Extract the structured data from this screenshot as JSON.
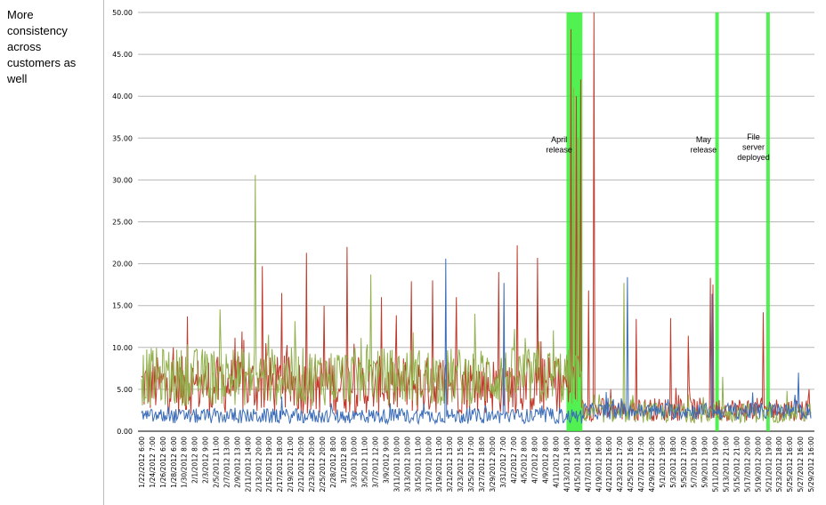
{
  "side_note": {
    "lines": [
      "More",
      "consistency",
      "across",
      "customers as",
      "well"
    ]
  },
  "colors": {
    "series_red": "#c0392b",
    "series_green": "#8fb04a",
    "series_blue": "#3b6cb7",
    "highlight": "#33ee33",
    "grid": "#b7b7b7"
  },
  "chart_data": {
    "type": "line",
    "title": "",
    "xlabel": "",
    "ylabel": "",
    "ylim": [
      0,
      50
    ],
    "yticks": [
      "0.00",
      "5.00",
      "10.00",
      "15.00",
      "20.00",
      "25.00",
      "30.00",
      "35.00",
      "40.00",
      "45.00",
      "50.00"
    ],
    "grid": true,
    "x_tick_labels": [
      "1/22/2012 6:00",
      "1/24/2012 7:00",
      "1/26/2012 6:00",
      "1/28/2012 6:00",
      "1/30/2012 8:00",
      "2/1/2012 8:00",
      "2/3/2012 9:00",
      "2/5/2012 11:00",
      "2/7/2012 13:00",
      "2/9/2012 13:00",
      "2/11/2012 14:00",
      "2/13/2012 20:00",
      "2/15/2012 19:00",
      "2/17/2012 18:00",
      "2/19/2012 21:00",
      "2/21/2012 20:00",
      "2/23/2012 20:00",
      "2/25/2012 20:00",
      "2/28/2012 8:00",
      "3/1/2012 8:00",
      "3/3/2012 10:00",
      "3/5/2012 11:00",
      "3/7/2012 12:00",
      "3/9/2012 9:00",
      "3/11/2012 10:00",
      "3/13/2012 10:00",
      "3/15/2012 11:00",
      "3/17/2012 10:00",
      "3/19/2012 11:00",
      "3/21/2012 13:00",
      "3/23/2012 15:00",
      "3/25/2012 17:00",
      "3/27/2012 18:00",
      "3/29/2012 20:00",
      "3/31/2012 7:00",
      "4/2/2012 7:00",
      "4/5/2012 8:00",
      "4/7/2012 8:00",
      "4/9/2012 8:00",
      "4/11/2012 8:00",
      "4/13/2012 14:00",
      "4/15/2012 14:00",
      "4/17/2012 14:00",
      "4/19/2012 16:00",
      "4/21/2012 16:00",
      "4/23/2012 17:00",
      "4/25/2012 16:00",
      "4/27/2012 17:00",
      "4/29/2012 20:00",
      "5/1/2012 19:00",
      "5/3/2012 18:00",
      "5/5/2012 17:00",
      "5/7/2012 19:00",
      "5/9/2012 19:00",
      "5/11/2012 19:00",
      "5/13/2012 21:00",
      "5/15/2012 21:00",
      "5/17/2012 20:00",
      "5/19/2012 20:00",
      "5/21/2012 19:00",
      "5/23/2012 18:00",
      "5/25/2012 16:00",
      "5/27/2012 16:00",
      "5/29/2012 16:00"
    ],
    "highlight_bands": [
      {
        "from_index": 40.0,
        "to_index": 41.5
      },
      {
        "from_index": 54.0,
        "to_index": 54.3
      },
      {
        "from_index": 58.8,
        "to_index": 59.1
      }
    ],
    "annotations": [
      {
        "lines": [
          "April",
          "release"
        ],
        "at_index": 39.3,
        "y": 34.5
      },
      {
        "lines": [
          "May",
          "release"
        ],
        "at_index": 52.9,
        "y": 34.5
      },
      {
        "lines": [
          "File",
          "server",
          "deployed"
        ],
        "at_index": 57.6,
        "y": 34.8
      }
    ],
    "series": [
      {
        "color_key": "series_red",
        "baseline_before": 5.5,
        "noise_before": 3.5,
        "baseline_after": 2.6,
        "noise_after": 1.4,
        "change_index": 41.5,
        "spikes": [
          [
            4.3,
            13.7
          ],
          [
            9.5,
            11.9
          ],
          [
            11.4,
            19.7
          ],
          [
            13.2,
            16.5
          ],
          [
            15.5,
            21.3
          ],
          [
            17.2,
            15.0
          ],
          [
            19.3,
            22.0
          ],
          [
            22.6,
            16.0
          ],
          [
            25.4,
            17.9
          ],
          [
            27.4,
            18.0
          ],
          [
            29.6,
            16.0
          ],
          [
            33.6,
            19.0
          ],
          [
            35.4,
            22.2
          ],
          [
            37.3,
            20.7
          ],
          [
            40.4,
            48.0
          ],
          [
            40.9,
            40.0
          ],
          [
            41.3,
            42.0
          ],
          [
            42.1,
            16.8
          ],
          [
            42.6,
            50.0
          ],
          [
            46.6,
            13.4
          ],
          [
            49.8,
            13.5
          ],
          [
            51.5,
            11.4
          ],
          [
            53.5,
            18.3
          ],
          [
            53.8,
            17.5
          ],
          [
            58.5,
            14.2
          ]
        ]
      },
      {
        "color_key": "series_green",
        "baseline_before": 6.5,
        "noise_before": 3.5,
        "baseline_after": 2.2,
        "noise_after": 1.2,
        "change_index": 41.5,
        "spikes": [
          [
            10.7,
            30.6
          ],
          [
            21.6,
            18.7
          ],
          [
            40.7,
            41.0
          ],
          [
            41.1,
            35.0
          ],
          [
            45.4,
            17.7
          ],
          [
            54.7,
            6.5
          ]
        ]
      },
      {
        "color_key": "series_blue",
        "baseline_before": 1.8,
        "noise_before": 0.9,
        "baseline_after": 2.4,
        "noise_after": 1.0,
        "change_index": 41.5,
        "spikes": [
          [
            28.6,
            20.6
          ],
          [
            34.1,
            17.7
          ],
          [
            45.7,
            18.4
          ],
          [
            53.7,
            16.4
          ],
          [
            61.8,
            7.0
          ]
        ]
      }
    ]
  }
}
